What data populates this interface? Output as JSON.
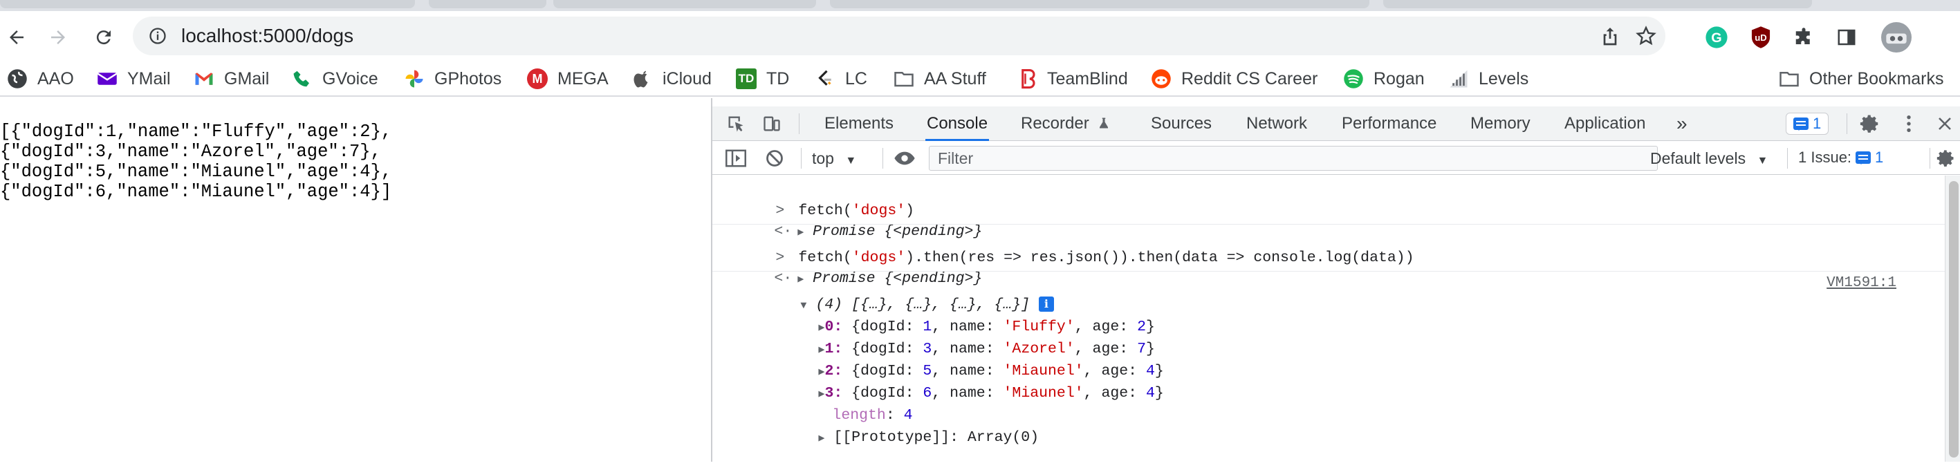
{
  "browser": {
    "url": "localhost:5000/dogs"
  },
  "bookmarks": [
    {
      "label": "AAO",
      "icon": "globe-icon",
      "color": "#3c4043"
    },
    {
      "label": "YMail",
      "icon": "mail-icon",
      "color": "#5f01d1"
    },
    {
      "label": "GMail",
      "icon": "gmail-icon",
      "color": "#ea4335"
    },
    {
      "label": "GVoice",
      "icon": "phone-icon",
      "color": "#0f9d58"
    },
    {
      "label": "GPhotos",
      "icon": "pinwheel-icon",
      "color": "#fbbc04"
    },
    {
      "label": "MEGA",
      "icon": "mega-icon",
      "color": "#d9272e"
    },
    {
      "label": "iCloud",
      "icon": "apple-icon",
      "color": "#555555"
    },
    {
      "label": "TD",
      "icon": "td-icon",
      "color": "#2a8a29"
    },
    {
      "label": "LC",
      "icon": "leetcode-icon",
      "color": "#f89f1b"
    },
    {
      "label": "AA Stuff",
      "icon": "folder-icon",
      "color": "#5f6368"
    },
    {
      "label": "TeamBlind",
      "icon": "blind-icon",
      "color": "#d9272e"
    },
    {
      "label": "Reddit CS Career",
      "icon": "reddit-icon",
      "color": "#ff4500"
    },
    {
      "label": "Rogan",
      "icon": "spotify-icon",
      "color": "#1db954"
    },
    {
      "label": "Levels",
      "icon": "levels-icon",
      "color": "#5f6368"
    }
  ],
  "other_bookmarks": "Other Bookmarks",
  "page_body": "[{\"dogId\":1,\"name\":\"Fluffy\",\"age\":2},\n{\"dogId\":3,\"name\":\"Azorel\",\"age\":7},\n{\"dogId\":5,\"name\":\"Miaunel\",\"age\":4},\n{\"dogId\":6,\"name\":\"Miaunel\",\"age\":4}]",
  "devtools": {
    "tabs": [
      "Elements",
      "Console",
      "Recorder",
      "Sources",
      "Network",
      "Performance",
      "Memory",
      "Application"
    ],
    "active_tab": "Console",
    "more_tabs": "»",
    "messages_count": "1",
    "context": "top",
    "filter_placeholder": "Filter",
    "levels": "Default levels",
    "issues_label": "1 Issue:",
    "issues_count": "1"
  },
  "console": {
    "cmd1": {
      "pre": "fetch(",
      "str": "'dogs'",
      "post": ")"
    },
    "result1": {
      "italic": "Promise",
      "rest": " {<pending>}"
    },
    "cmd2": {
      "pre": "fetch(",
      "str": "'dogs'",
      "post": ").then(res => res.json()).then(data => console.log(data))"
    },
    "result2": {
      "italic": "Promise",
      "rest": " {<pending>}"
    },
    "log_summary": "(4) [{…}, {…}, {…}, {…}]",
    "log_source": "VM1591:1",
    "items": [
      {
        "idx": "0",
        "dogId": "1",
        "name": "'Fluffy'",
        "age": "2"
      },
      {
        "idx": "1",
        "dogId": "3",
        "name": "'Azorel'",
        "age": "7"
      },
      {
        "idx": "2",
        "dogId": "5",
        "name": "'Miaunel'",
        "age": "4"
      },
      {
        "idx": "3",
        "dogId": "6",
        "name": "'Miaunel'",
        "age": "4"
      }
    ],
    "length_key": "length",
    "length_val": "4",
    "prototype": "[[Prototype]]: Array(0)"
  }
}
